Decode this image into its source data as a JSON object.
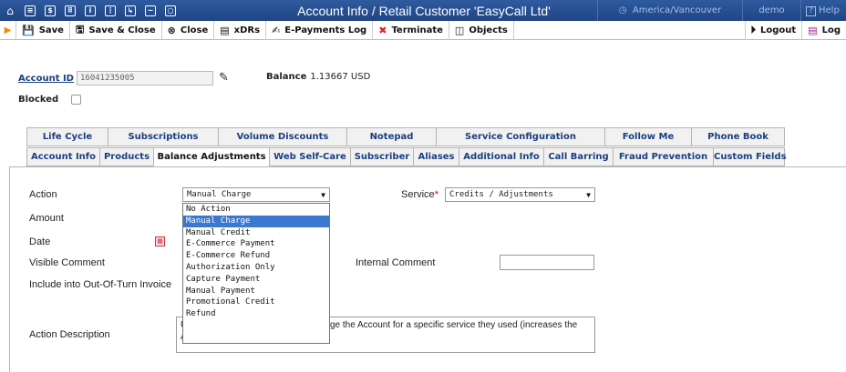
{
  "window": {
    "title": "Account Info / Retail Customer 'EasyCall Ltd'",
    "timezone": "America/Vancouver",
    "user": "demo",
    "help": "Help"
  },
  "toolbar": {
    "save": "Save",
    "save_close": "Save & Close",
    "close": "Close",
    "xdrs": "xDRs",
    "epayments": "E-Payments Log",
    "terminate": "Terminate",
    "objects": "Objects",
    "logout": "Logout",
    "log": "Log"
  },
  "account": {
    "id_label": "Account ID",
    "id_value": "16041235005",
    "balance_label": "Balance",
    "balance_value": "1.13667 USD",
    "blocked_label": "Blocked"
  },
  "tabs_row1": [
    "Life Cycle",
    "Subscriptions",
    "Volume Discounts",
    "Notepad",
    "Service Configuration",
    "Follow Me",
    "Phone Book"
  ],
  "tabs_row2": [
    "Account Info",
    "Products",
    "Balance Adjustments",
    "Web Self-Care",
    "Subscriber",
    "Aliases",
    "Additional Info",
    "Call Barring",
    "Fraud Prevention",
    "Custom Fields"
  ],
  "active_tab": "Balance Adjustments",
  "form": {
    "action_label": "Action",
    "action_value": "Manual Charge",
    "amount_label": "Amount",
    "date_label": "Date",
    "visible_comment_label": "Visible Comment",
    "include_label": "Include into Out-Of-Turn Invoice",
    "service_label": "Service",
    "service_value": "Credits / Adjustments",
    "internal_comment_label": "Internal Comment",
    "action_desc_label": "Action Description",
    "action_desc_text": "Use this transaction to manually charge the Account for a specific service they used (increases the Account's balance)."
  },
  "action_options": [
    "No Action",
    "Manual Charge",
    "Manual Credit",
    "E-Commerce Payment",
    "E-Commerce Refund",
    "Authorization Only",
    "Capture Payment",
    "Manual Payment",
    "Promotional Credit",
    "Refund"
  ],
  "selected_option_index": 1
}
